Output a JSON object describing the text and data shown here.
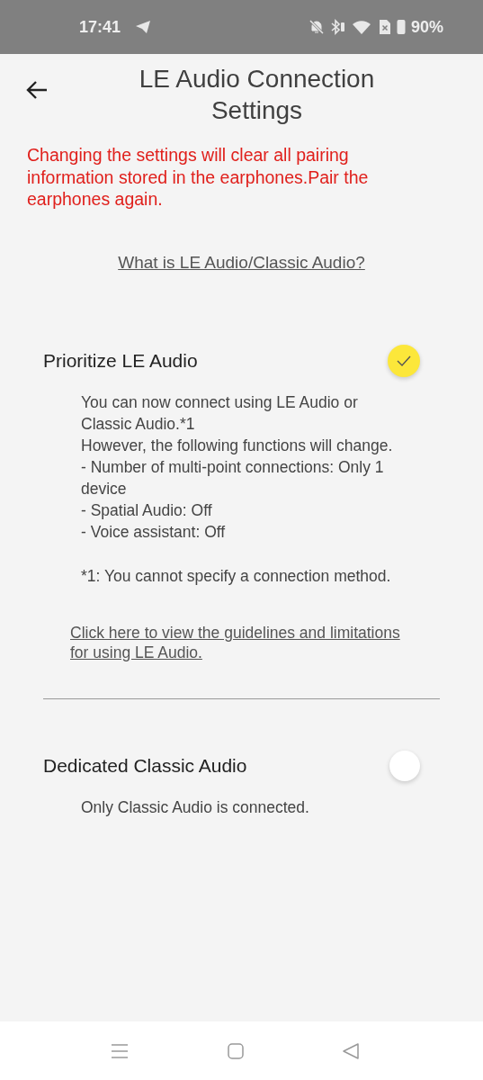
{
  "status_bar": {
    "time": "17:41",
    "battery": "90%"
  },
  "header": {
    "title": "LE Audio Connection Settings"
  },
  "warning": "Changing the settings will clear all pairing information stored in the earphones.Pair the earphones again.",
  "help_link": "What is LE Audio/Classic Audio?",
  "options": [
    {
      "label": "Prioritize LE Audio",
      "selected": true,
      "description": [
        "You can now connect using LE Audio or Classic Audio.*1",
        "However, the following functions will change.",
        "- Number of multi-point connections: Only 1 device",
        "- Spatial Audio: Off",
        "- Voice assistant: Off"
      ],
      "note": "*1: You cannot specify a connection method.",
      "link": "Click here to view the guidelines and limitations for using LE Audio."
    },
    {
      "label": "Dedicated Classic Audio",
      "selected": false,
      "description": [
        "Only Classic Audio is connected."
      ]
    }
  ]
}
